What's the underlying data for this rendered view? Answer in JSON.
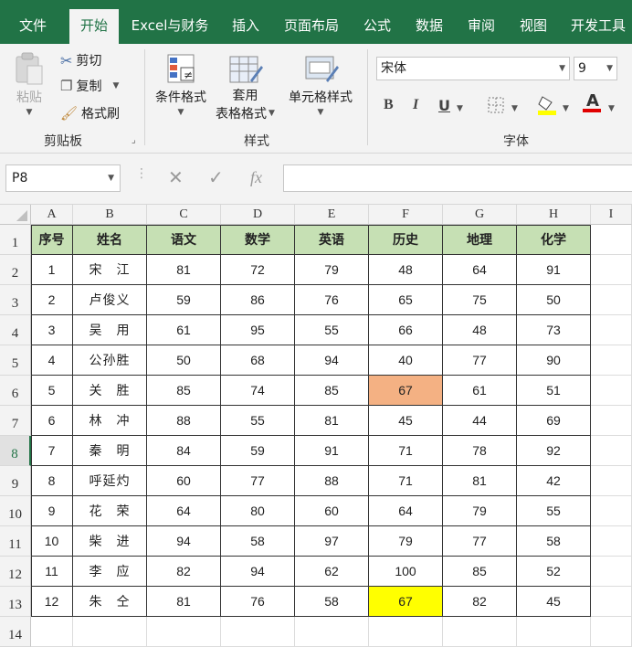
{
  "tabs": [
    "文件",
    "开始",
    "Excel与财务",
    "插入",
    "页面布局",
    "公式",
    "数据",
    "审阅",
    "视图",
    "开发工具"
  ],
  "active_tab": "开始",
  "ribbon": {
    "clipboard": {
      "paste": "粘贴",
      "cut": "剪切",
      "copy": "复制",
      "format_painter": "格式刷",
      "group_label": "剪贴板"
    },
    "styles": {
      "conditional_format": "条件格式",
      "table_format_1": "套用",
      "table_format_2": "表格格式",
      "cell_styles": "单元格样式",
      "group_label": "样式"
    },
    "font": {
      "font_name": "宋体",
      "font_size": "9",
      "bold": "B",
      "italic": "I",
      "underline": "U",
      "font_color_letter": "A",
      "group_label": "字体"
    }
  },
  "formula_bar": {
    "name_box": "P8",
    "fx": "fx",
    "formula": ""
  },
  "colors": {
    "accent": "#217346",
    "header_fill": "#c6e0b4",
    "orange_fill": "#f4b183",
    "yellow_fill": "#ffff00"
  },
  "columns": [
    "A",
    "B",
    "C",
    "D",
    "E",
    "F",
    "G",
    "H",
    "I"
  ],
  "rows": [
    "1",
    "2",
    "3",
    "4",
    "5",
    "6",
    "7",
    "8",
    "9",
    "10",
    "11",
    "12",
    "13",
    "14"
  ],
  "active_row": "8",
  "table": {
    "headers": [
      "序号",
      "姓名",
      "语文",
      "数学",
      "英语",
      "历史",
      "地理",
      "化学"
    ],
    "rows": [
      [
        "1",
        "宋　江",
        "81",
        "72",
        "79",
        "48",
        "64",
        "91"
      ],
      [
        "2",
        "卢俊义",
        "59",
        "86",
        "76",
        "65",
        "75",
        "50"
      ],
      [
        "3",
        "吴　用",
        "61",
        "95",
        "55",
        "66",
        "48",
        "73"
      ],
      [
        "4",
        "公孙胜",
        "50",
        "68",
        "94",
        "40",
        "77",
        "90"
      ],
      [
        "5",
        "关　胜",
        "85",
        "74",
        "85",
        "67",
        "61",
        "51"
      ],
      [
        "6",
        "林　冲",
        "88",
        "55",
        "81",
        "45",
        "44",
        "69"
      ],
      [
        "7",
        "秦　明",
        "84",
        "59",
        "91",
        "71",
        "78",
        "92"
      ],
      [
        "8",
        "呼延灼",
        "60",
        "77",
        "88",
        "71",
        "81",
        "42"
      ],
      [
        "9",
        "花　荣",
        "64",
        "80",
        "60",
        "64",
        "79",
        "55"
      ],
      [
        "10",
        "柴　进",
        "94",
        "58",
        "97",
        "79",
        "77",
        "58"
      ],
      [
        "11",
        "李　应",
        "82",
        "94",
        "62",
        "100",
        "85",
        "52"
      ],
      [
        "12",
        "朱　仝",
        "81",
        "76",
        "58",
        "67",
        "82",
        "45"
      ]
    ],
    "highlights": [
      {
        "row": 4,
        "col": 5,
        "color": "#f4b183"
      },
      {
        "row": 11,
        "col": 5,
        "color": "#ffff00"
      }
    ]
  }
}
